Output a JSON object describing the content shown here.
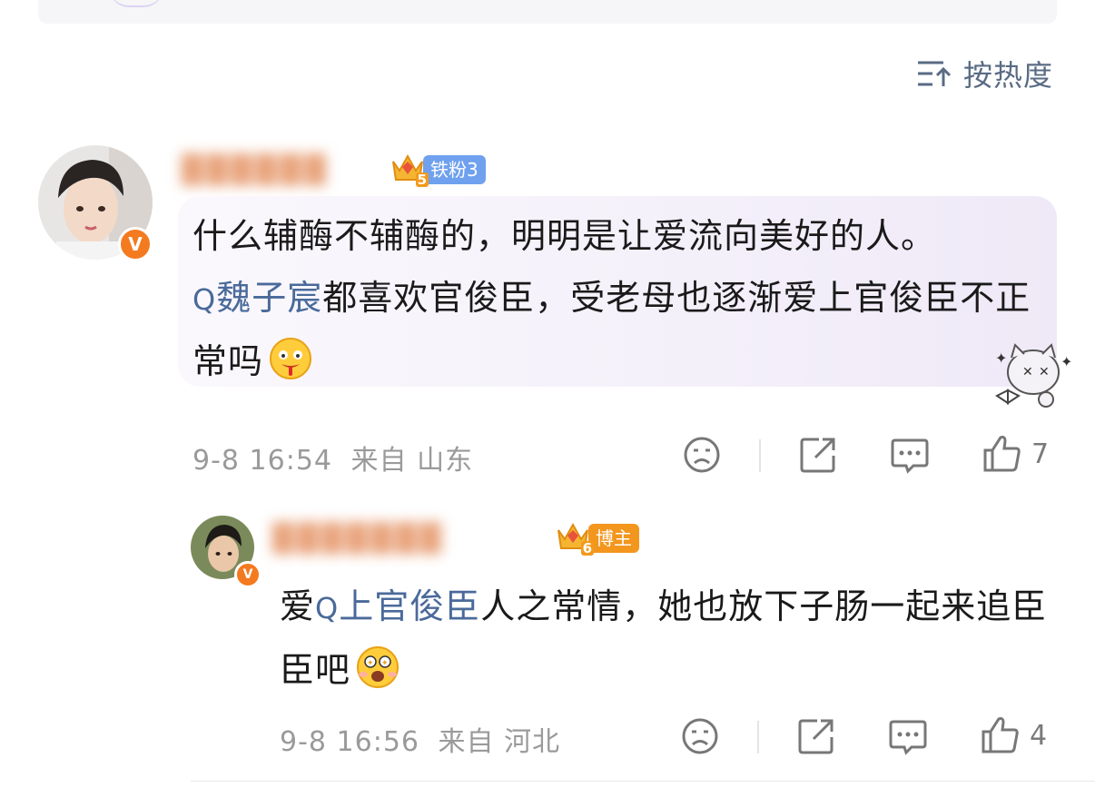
{
  "sort": {
    "label": "按热度"
  },
  "comments": [
    {
      "username": "██████",
      "badge": {
        "level": "5",
        "tag": "铁粉3"
      },
      "verified": "V",
      "text": {
        "part1": "什么辅酶不辅酶的，明明是让爱流向美好的人。",
        "mention": "魏子宸",
        "part2": "都喜欢官俊臣，受老母也逐渐爱上官俊臣不正常吗",
        "emoji": "drooling-emoji"
      },
      "time": "9-8 16:54",
      "from": "来自 山东",
      "likes": "7"
    },
    {
      "username": "███████",
      "badge": {
        "level": "6",
        "tag": "博主"
      },
      "verified": "V",
      "text": {
        "part1": "爱",
        "mention": "上官俊臣",
        "part2": "人之常情，她也放下子肠一起来追臣臣吧",
        "emoji": "excited-emoji"
      },
      "time": "9-8 16:56",
      "from": "来自 河北",
      "likes": "4"
    }
  ],
  "colors": {
    "mention": "#4a6a9a",
    "meta": "#9a9a9a",
    "verified": "#f47a1f"
  }
}
